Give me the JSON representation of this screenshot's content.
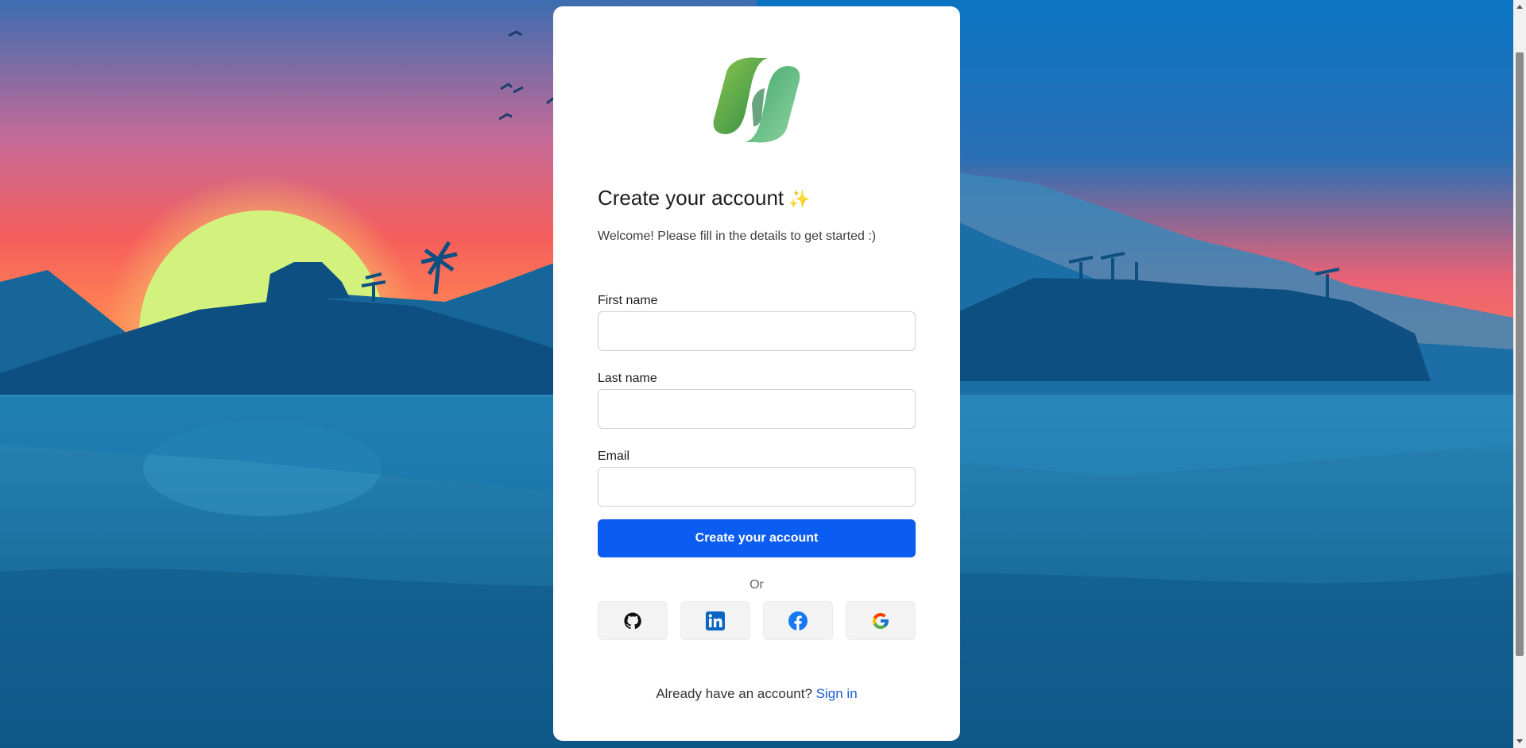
{
  "logo": {
    "icon": "copilot-logo-icon"
  },
  "title": "Create your account",
  "title_emoji": "✨",
  "subtitle": "Welcome! Please fill in the details to get started :)",
  "form": {
    "first_name_label": "First name",
    "first_name_value": "",
    "last_name_label": "Last name",
    "last_name_value": "",
    "email_label": "Email",
    "email_value": "",
    "submit_label": "Create your account"
  },
  "divider_text": "Or",
  "social": [
    {
      "name": "github",
      "icon": "github-icon"
    },
    {
      "name": "linkedin",
      "icon": "linkedin-icon"
    },
    {
      "name": "facebook",
      "icon": "facebook-icon"
    },
    {
      "name": "google",
      "icon": "google-icon"
    }
  ],
  "footer": {
    "prompt": "Already have an account?",
    "link": "Sign in"
  },
  "colors": {
    "primary_button": "#0b5cf0",
    "link": "#1a5cd6",
    "sky_top": "#2e6fb5",
    "sunset": "#f25a5a",
    "sun": "#d9f27e",
    "water": "#1e6fa6"
  }
}
